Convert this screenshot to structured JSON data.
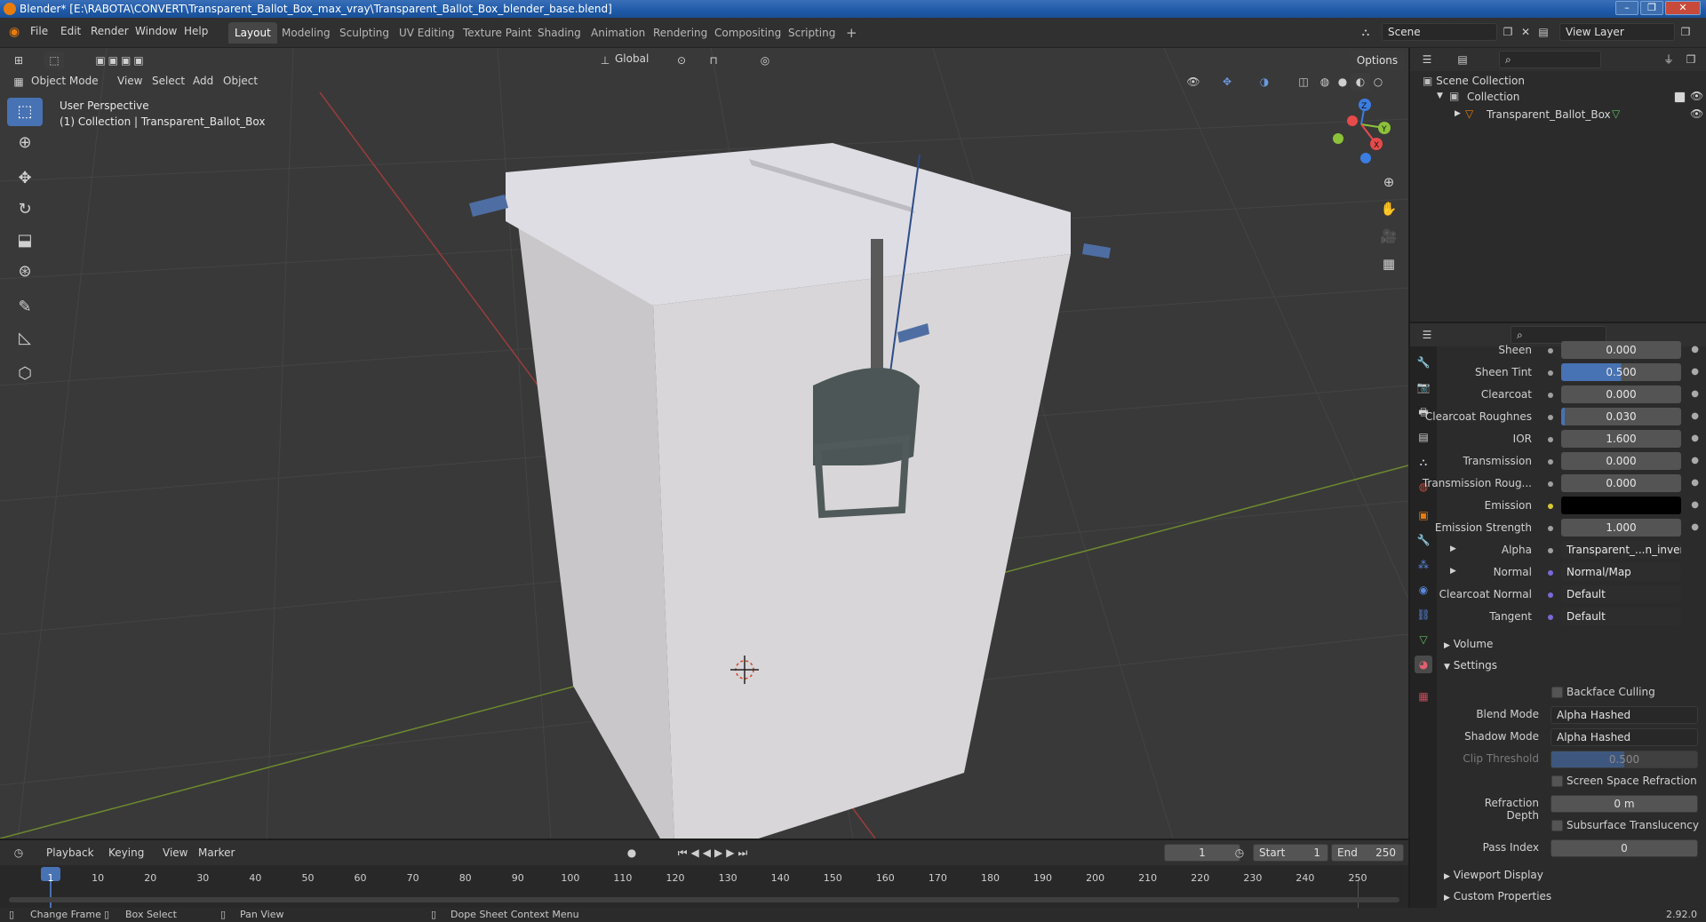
{
  "window": {
    "title": "Blender* [E:\\RABOTA\\CONVERT\\Transparent_Ballot_Box_max_vray\\Transparent_Ballot_Box_blender_base.blend]",
    "controls": [
      "–",
      "❐",
      "✕"
    ]
  },
  "menu": [
    "File",
    "Edit",
    "Render",
    "Window",
    "Help"
  ],
  "workspaces": [
    "Layout",
    "Modeling",
    "Sculpting",
    "UV Editing",
    "Texture Paint",
    "Shading",
    "Animation",
    "Rendering",
    "Compositing",
    "Scripting"
  ],
  "active_workspace": "Layout",
  "add_workspace": "+",
  "scene": {
    "name": "Scene",
    "view_layer": "View Layer"
  },
  "viewport": {
    "mode": "Object Mode",
    "menus": [
      "View",
      "Select",
      "Add",
      "Object"
    ],
    "orientation": "Global",
    "options": "Options",
    "perspective_label": "User Perspective",
    "collection_label": "(1) Collection | Transparent_Ballot_Box"
  },
  "gizmo": {
    "x": "X",
    "y": "Y",
    "z": "Z"
  },
  "outliner": {
    "root": "Scene Collection",
    "collection": "Collection",
    "object": "Transparent_Ballot_Box"
  },
  "properties": {
    "rows": [
      {
        "label": "Sheen",
        "value": "0.000"
      },
      {
        "label": "Sheen Tint",
        "value": "0.500"
      },
      {
        "label": "Clearcoat",
        "value": "0.000"
      },
      {
        "label": "Clearcoat Roughnes",
        "value": "0.030"
      },
      {
        "label": "IOR",
        "value": "1.600"
      },
      {
        "label": "Transmission",
        "value": "0.000"
      },
      {
        "label": "Transmission Roug...",
        "value": "0.000"
      },
      {
        "label": "Emission",
        "value": ""
      },
      {
        "label": "Emission Strength",
        "value": "1.000"
      },
      {
        "label": "Alpha",
        "value": "Transparent_...n_invert.png"
      },
      {
        "label": "Normal",
        "value": "Normal/Map"
      },
      {
        "label": "Clearcoat Normal",
        "value": "Default"
      },
      {
        "label": "Tangent",
        "value": "Default"
      }
    ],
    "volume": "Volume",
    "settings": "Settings",
    "backface_culling": "Backface Culling",
    "blend_mode_label": "Blend Mode",
    "blend_mode": "Alpha Hashed",
    "shadow_mode_label": "Shadow Mode",
    "shadow_mode": "Alpha Hashed",
    "clip_threshold_label": "Clip Threshold",
    "clip_threshold": "0.500",
    "ssr": "Screen Space Refraction",
    "refraction_depth_label": "Refraction Depth",
    "refraction_depth": "0 m",
    "sss": "Subsurface Translucency",
    "pass_index_label": "Pass Index",
    "pass_index": "0",
    "viewport_display": "Viewport Display",
    "custom_properties": "Custom Properties"
  },
  "timeline": {
    "menus": [
      "Playback",
      "Keying",
      "View",
      "Marker"
    ],
    "current_frame": "1",
    "start_label": "Start",
    "start": "1",
    "end_label": "End",
    "end": "250",
    "ticks": [
      "1",
      "10",
      "20",
      "30",
      "40",
      "50",
      "60",
      "70",
      "80",
      "90",
      "100",
      "110",
      "120",
      "130",
      "140",
      "150",
      "160",
      "170",
      "180",
      "190",
      "200",
      "210",
      "220",
      "230",
      "240",
      "250"
    ]
  },
  "statusbar": {
    "change_frame": "Change Frame",
    "box_select": "Box Select",
    "pan_view": "Pan View",
    "context_menu": "Dope Sheet Context Menu",
    "version": "2.92.0"
  },
  "colors": {
    "accent": "#4772b3",
    "object_orange": "#e87d0d",
    "axis_x": "#e64a4a",
    "axis_y": "#8cc23a",
    "axis_z": "#3b7de0"
  }
}
